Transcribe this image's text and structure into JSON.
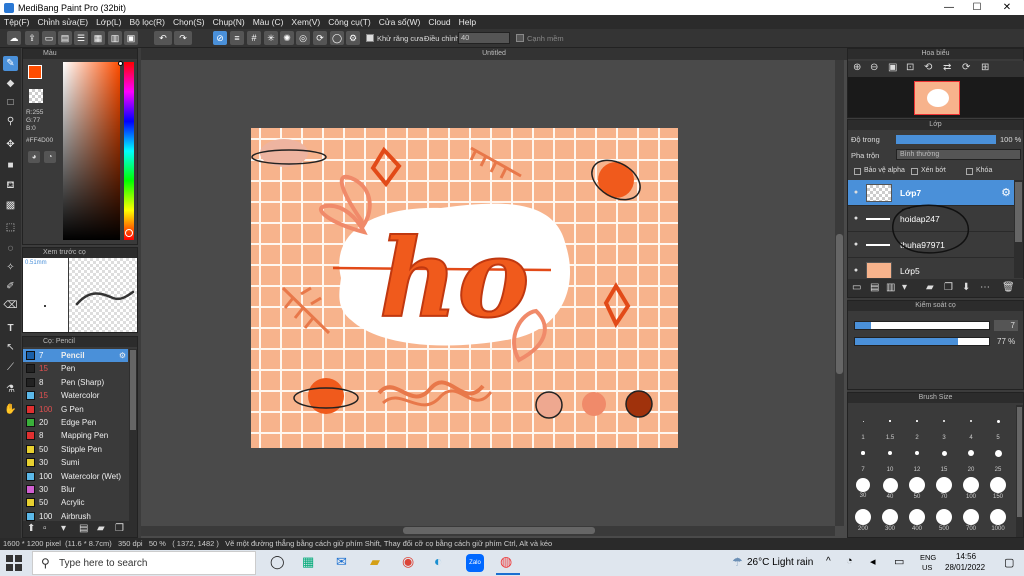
{
  "app": {
    "title": "MediBang Paint Pro (32bit)"
  },
  "menu": [
    "Tệp(F)",
    "Chỉnh sửa(E)",
    "Lớp(L)",
    "Bộ lọc(R)",
    "Chọn(S)",
    "Chụp(N)",
    "Màu (C)",
    "Xem(V)",
    "Công cụ(T)",
    "Cửa sổ(W)",
    "Cloud",
    "Help"
  ],
  "toolbar": {
    "antialias": "Khử răng cưa",
    "adjust_label": "Điều chỉnh",
    "adjust_value": "40",
    "smooth": "Cạnh mềm"
  },
  "color_panel": {
    "title": "Màu",
    "r": "R:255",
    "g": "G:77",
    "b": "B:0",
    "hex": "#FF4D00",
    "main_color": "#ff4d00"
  },
  "preview_panel": {
    "title": "Xem trước cọ",
    "size": "0.51mm"
  },
  "brush_panel": {
    "title": "Cọ: Pencil",
    "brushes": [
      {
        "size": "7",
        "name": "Pencil",
        "color": "#1a5fa8",
        "sel": true
      },
      {
        "size": "15",
        "name": "Pen",
        "color": "#222"
      },
      {
        "size": "8",
        "name": "Pen (Sharp)",
        "color": "#222"
      },
      {
        "size": "15",
        "name": "Watercolor",
        "color": "#5bb8e8"
      },
      {
        "size": "100",
        "name": "G Pen",
        "color": "#e03030"
      },
      {
        "size": "20",
        "name": "Edge Pen",
        "color": "#3ab03a"
      },
      {
        "size": "8",
        "name": "Mapping Pen",
        "color": "#e03030"
      },
      {
        "size": "50",
        "name": "Stipple Pen",
        "color": "#e8d030"
      },
      {
        "size": "30",
        "name": "Sumi",
        "color": "#e8d030"
      },
      {
        "size": "100",
        "name": "Watercolor (Wet)",
        "color": "#5bb8e8"
      },
      {
        "size": "30",
        "name": "Blur",
        "color": "#d060d0"
      },
      {
        "size": "50",
        "name": "Acrylic",
        "color": "#e8d030"
      },
      {
        "size": "100",
        "name": "Airbrush",
        "color": "#5bb8e8"
      }
    ]
  },
  "document": {
    "title": "Untitled",
    "text": "ho"
  },
  "navigator": {
    "title": "Hoa biểu"
  },
  "layer_panel": {
    "title": "Lớp",
    "opacity_label": "Độ trong",
    "opacity_value": "100 %",
    "blend_label": "Pha trộn",
    "blend_value": "Bình thường",
    "protect_alpha": "Bảo vệ alpha",
    "clipping": "Xén bớt",
    "lock": "Khóa",
    "layers": [
      {
        "name": "Lớp7",
        "sel": true
      },
      {
        "name": "hoidap247"
      },
      {
        "name": "thuha97971"
      },
      {
        "name": "Lớp5"
      }
    ]
  },
  "brush_control": {
    "title": "Kiểm soát cọ",
    "size_value": "7",
    "opacity_value": "77 %",
    "size_fill": 0.12,
    "opacity_fill": 0.77
  },
  "brush_size": {
    "title": "Brush Size",
    "sizes": [
      "1",
      "1.5",
      "2",
      "3",
      "4",
      "5",
      "7",
      "10",
      "12",
      "15",
      "20",
      "25",
      "30",
      "40",
      "50",
      "70",
      "100",
      "150",
      "200",
      "300",
      "400",
      "500",
      "700",
      "1000"
    ]
  },
  "status": {
    "pixels": "1600 * 1200 pixel",
    "cm": "(11.6 * 8.7cm)",
    "dpi": "350 dpi",
    "zoom": "50 %",
    "coords": "( 1372, 1482 )",
    "hint": "Vẽ một đường thẳng bằng cách giữ phím Shift, Thay đổi cỡ cọ bằng cách giữ phím Ctrl, Alt và kéo"
  },
  "taskbar": {
    "search": "Type here to search",
    "weather": "26°C  Light rain",
    "lang1": "ENG",
    "lang2": "US",
    "time": "14:56",
    "date": "28/01/2022",
    "zalo": "Zalo"
  }
}
